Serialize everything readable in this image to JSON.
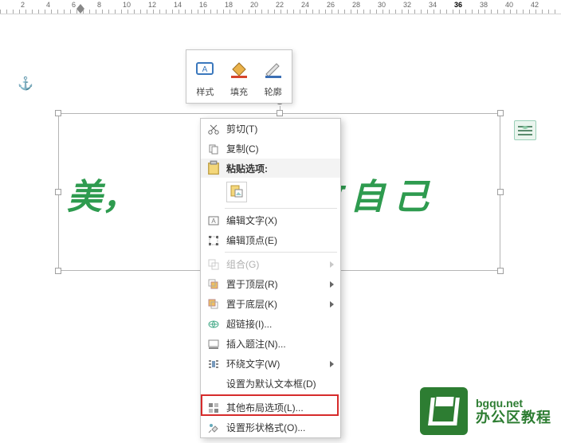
{
  "ruler": {
    "marks": [
      2,
      4,
      6,
      8,
      10,
      12,
      14,
      16,
      18,
      20,
      22,
      24,
      26,
      28,
      30,
      32,
      34,
      36,
      38,
      40,
      42
    ]
  },
  "textbox": {
    "content_left": "美，",
    "content_right": "敢 自 己"
  },
  "mini_toolbar": {
    "style": "样式",
    "fill": "填充",
    "outline": "轮廓"
  },
  "context_menu": {
    "cut": "剪切(T)",
    "copy": "复制(C)",
    "paste_header": "粘贴选项:",
    "edit_text": "编辑文字(X)",
    "edit_points": "编辑顶点(E)",
    "group": "组合(G)",
    "bring_front": "置于顶层(R)",
    "send_back": "置于底层(K)",
    "hyperlink": "超链接(I)...",
    "insert_caption": "插入题注(N)...",
    "wrap_text": "环绕文字(W)",
    "default_textbox": "设置为默认文本框(D)",
    "more_layout": "其他布局选项(L)...",
    "format_shape": "设置形状格式(O)..."
  },
  "brand": {
    "url": "bgqu.net",
    "name": "办公区教程"
  }
}
